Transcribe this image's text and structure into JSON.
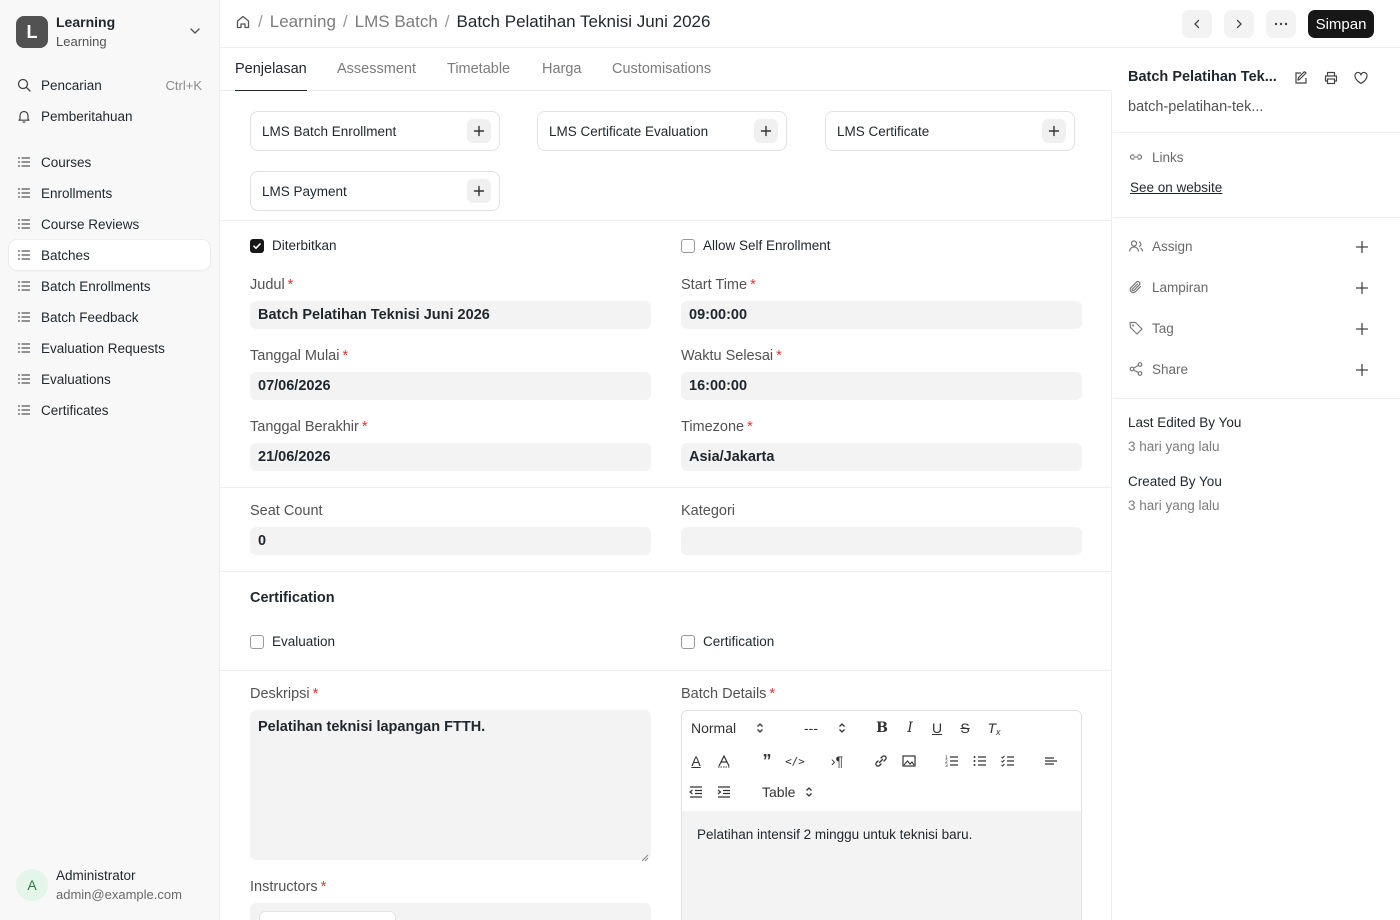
{
  "sidebar": {
    "app": {
      "logo_letter": "L",
      "title": "Learning",
      "subtitle": "Learning"
    },
    "search": {
      "label": "Pencarian",
      "shortcut": "Ctrl+K"
    },
    "notifications": {
      "label": "Pemberitahuan"
    },
    "items": [
      {
        "label": "Courses"
      },
      {
        "label": "Enrollments"
      },
      {
        "label": "Course Reviews"
      },
      {
        "label": "Batches"
      },
      {
        "label": "Batch Enrollments"
      },
      {
        "label": "Batch Feedback"
      },
      {
        "label": "Evaluation Requests"
      },
      {
        "label": "Evaluations"
      },
      {
        "label": "Certificates"
      }
    ],
    "user": {
      "initial": "A",
      "name": "Administrator",
      "email": "admin@example.com"
    }
  },
  "header": {
    "breadcrumbs": [
      "Learning",
      "LMS Batch",
      "Batch Pelatihan Teknisi Juni 2026"
    ],
    "save_label": "Simpan"
  },
  "tabs": [
    "Penjelasan",
    "Assessment",
    "Timetable",
    "Harga",
    "Customisations"
  ],
  "connections": [
    "LMS Batch Enrollment",
    "LMS Certificate Evaluation",
    "LMS Certificate",
    "LMS Payment"
  ],
  "form": {
    "published": {
      "label": "Diterbitkan",
      "checked": true
    },
    "allow_self_enrollment": {
      "label": "Allow Self Enrollment",
      "checked": false
    },
    "title": {
      "label": "Judul",
      "value": "Batch Pelatihan Teknisi Juni 2026"
    },
    "start_time": {
      "label": "Start Time",
      "value": "09:00:00"
    },
    "start_date": {
      "label": "Tanggal Mulai",
      "value": "07/06/2026"
    },
    "end_time": {
      "label": "Waktu Selesai",
      "value": "16:00:00"
    },
    "end_date": {
      "label": "Tanggal Berakhir",
      "value": "21/06/2026"
    },
    "timezone": {
      "label": "Timezone",
      "value": "Asia/Jakarta"
    },
    "seat_count": {
      "label": "Seat Count",
      "value": "0"
    },
    "category": {
      "label": "Kategori",
      "value": ""
    },
    "certification_section": "Certification",
    "evaluation": {
      "label": "Evaluation",
      "checked": false
    },
    "certification": {
      "label": "Certification",
      "checked": false
    },
    "description": {
      "label": "Deskripsi",
      "value": "Pelatihan teknisi lapangan FTTH."
    },
    "batch_details": {
      "label": "Batch Details",
      "format_select": "Normal",
      "size_select": "---",
      "table_select": "Table",
      "content": "Pelatihan intensif 2 minggu untuk teknisi baru."
    },
    "instructors": {
      "label": "Instructors"
    },
    "required_mark": "*"
  },
  "right_panel": {
    "title": "Batch Pelatihan Tek...",
    "name": "batch-pelatihan-tek...",
    "links_label": "Links",
    "see_on_website": "See on website",
    "actions": [
      "Assign",
      "Lampiran",
      "Tag",
      "Share"
    ],
    "last_edited": "Last Edited By You",
    "last_edited_when": "3 hari yang lalu",
    "created": "Created By You",
    "created_when": "3 hari yang lalu"
  }
}
